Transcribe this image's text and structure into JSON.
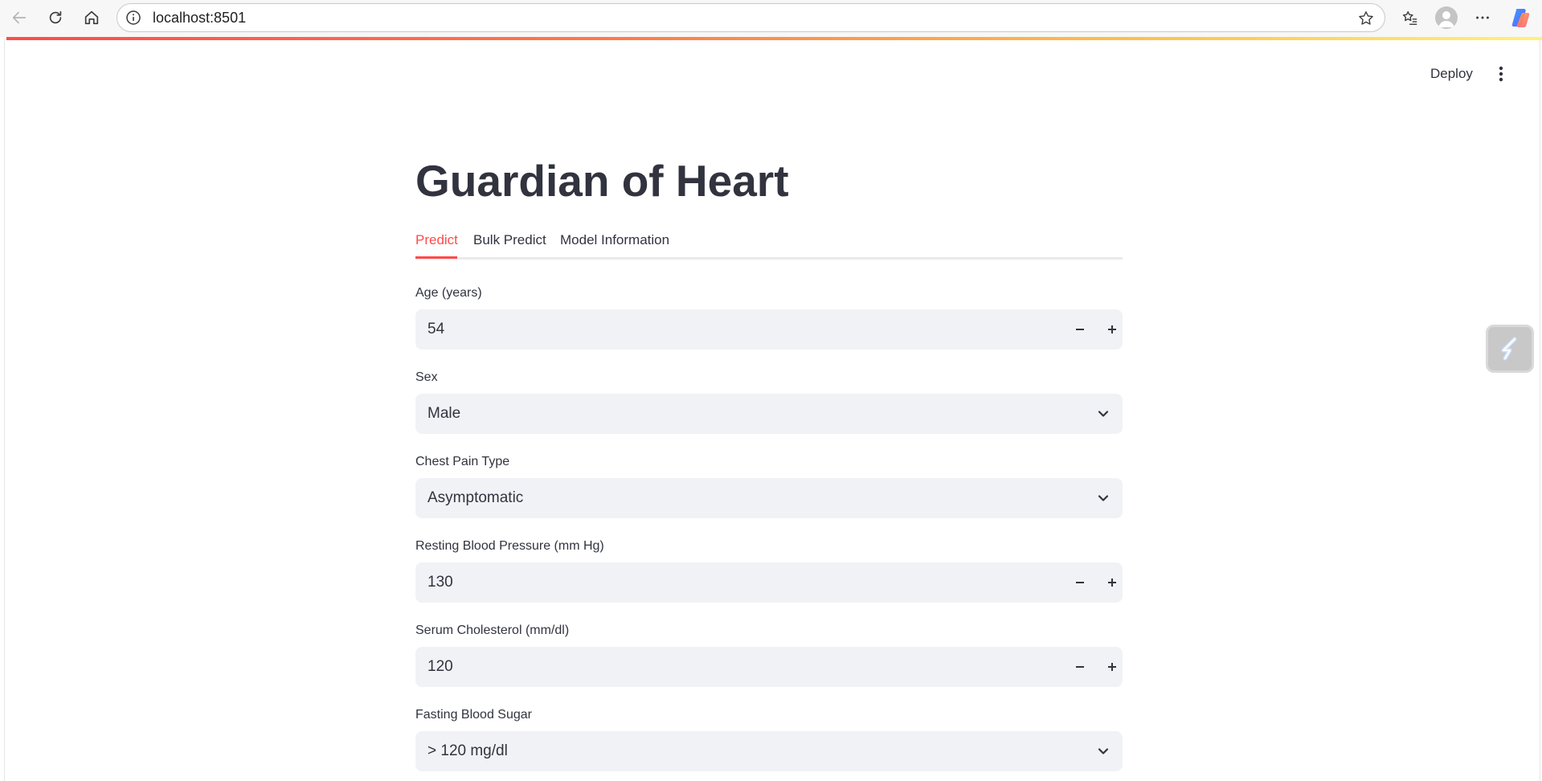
{
  "browser": {
    "url": "localhost:8501"
  },
  "app": {
    "deploy_label": "Deploy"
  },
  "page": {
    "title": "Guardian of Heart"
  },
  "tabs": [
    {
      "label": "Predict",
      "active": true
    },
    {
      "label": "Bulk Predict",
      "active": false
    },
    {
      "label": "Model Information",
      "active": false
    }
  ],
  "form": {
    "age": {
      "label": "Age (years)",
      "value": "54"
    },
    "sex": {
      "label": "Sex",
      "value": "Male"
    },
    "chest_pain": {
      "label": "Chest Pain Type",
      "value": "Asymptomatic"
    },
    "resting_bp": {
      "label": "Resting Blood Pressure (mm Hg)",
      "value": "130"
    },
    "cholesterol": {
      "label": "Serum Cholesterol (mm/dl)",
      "value": "120"
    },
    "fasting_bs": {
      "label": "Fasting Blood Sugar",
      "value": "> 120 mg/dl"
    }
  },
  "colors": {
    "accent": "#ff4b4b",
    "text": "#31333f",
    "input_bg": "#f0f2f6"
  }
}
